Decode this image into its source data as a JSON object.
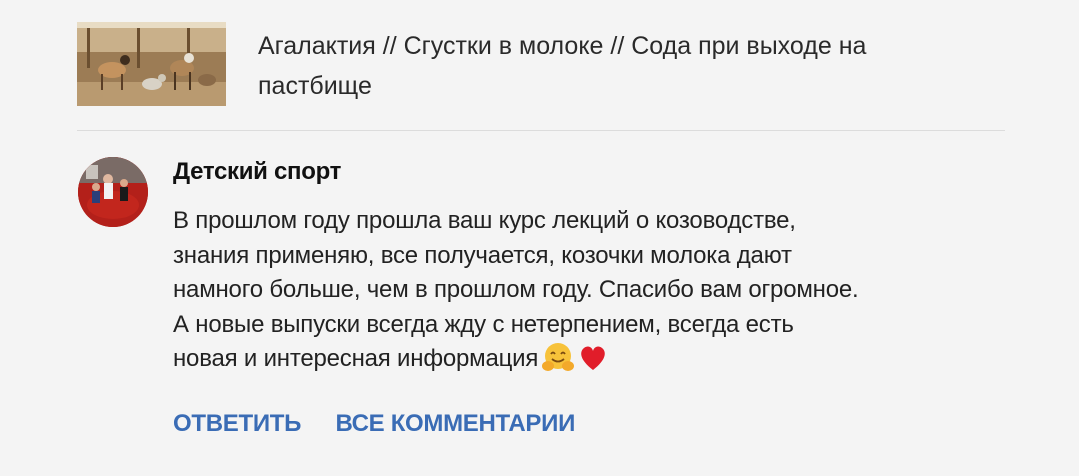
{
  "video": {
    "title": "Агалактия // Сгустки в молоке // Сода при выходе на пастбище",
    "thumbnail_icon": "goats-thumbnail"
  },
  "comment": {
    "author": "Детский спорт",
    "avatar_icon": "avatar-photo",
    "lines": [
      "В прошлом году прошла ваш курс лекций о козоводстве,",
      "знания применяю, все получается, козочки молока дают",
      "намного больше, чем в прошлом году. Спасибо вам огромное.",
      "А новые выпуски всегда жду с нетерпением, всегда есть",
      "новая и интересная информация"
    ],
    "emojis": [
      "hugging-face-emoji",
      "red-heart-emoji"
    ]
  },
  "actions": {
    "reply_label": "ОТВЕТИТЬ",
    "all_comments_label": "ВСЕ КОММЕНТАРИИ"
  }
}
